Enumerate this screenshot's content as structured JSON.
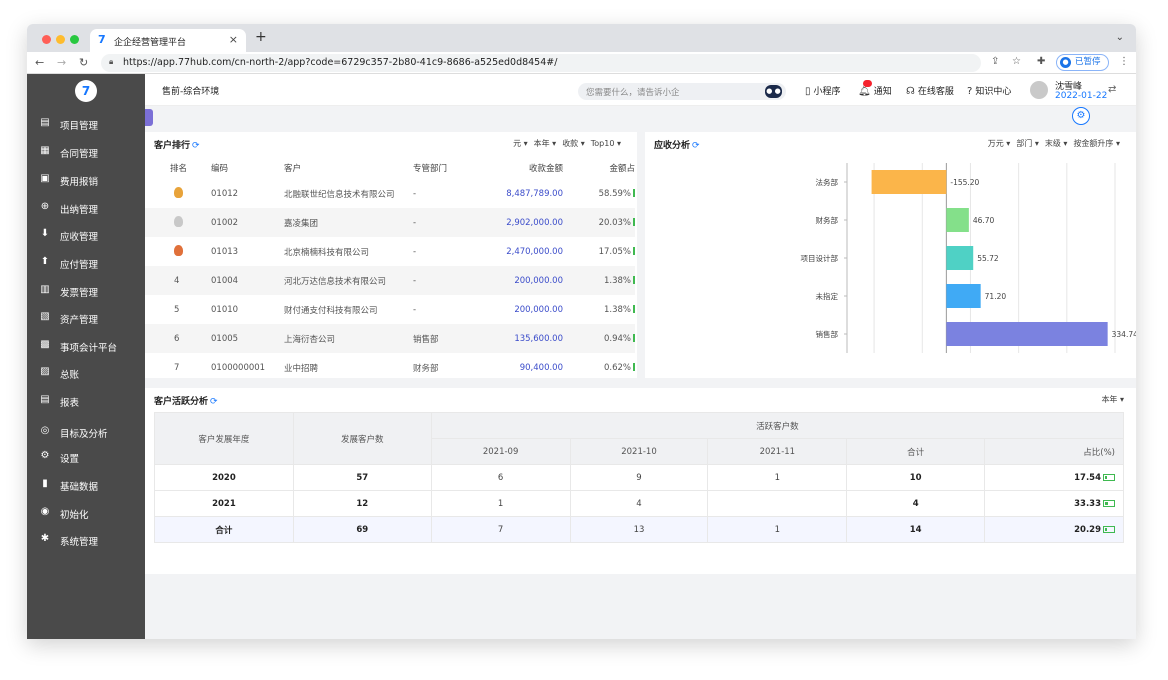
{
  "browser": {
    "tab_title": "企企经营管理平台",
    "url": "https://app.77hub.com/cn-north-2/app?code=6729c357-2b80-41c9-8686-a525ed0d8454#/",
    "paused_label": "已暂停",
    "window_dots": [
      "#ff5f57",
      "#febc2e",
      "#28c840"
    ]
  },
  "sidebar": {
    "items": [
      {
        "label": "项目管理",
        "icon": "folder-icon"
      },
      {
        "label": "合同管理",
        "icon": "contract-icon"
      },
      {
        "label": "费用报销",
        "icon": "expense-icon"
      },
      {
        "label": "出纳管理",
        "icon": "cashier-icon"
      },
      {
        "label": "应收管理",
        "icon": "receivable-icon"
      },
      {
        "label": "应付管理",
        "icon": "payable-icon"
      },
      {
        "label": "发票管理",
        "icon": "invoice-icon"
      },
      {
        "label": "资产管理",
        "icon": "asset-icon"
      },
      {
        "label": "事项会计平台",
        "icon": "grid-icon"
      },
      {
        "label": "总账",
        "icon": "ledger-icon"
      },
      {
        "label": "报表",
        "icon": "report-icon"
      },
      {
        "label": "目标及分析",
        "icon": "target-icon"
      },
      {
        "label": "设置",
        "icon": "gear-icon"
      },
      {
        "label": "基础数据",
        "icon": "bar-chart-icon"
      },
      {
        "label": "初始化",
        "icon": "init-icon"
      },
      {
        "label": "系统管理",
        "icon": "system-icon"
      }
    ]
  },
  "header": {
    "env": "售前-综合环境",
    "search_placeholder": "您需要什么，请告诉小企",
    "miniprogram": "小程序",
    "notify": "通知",
    "service": "在线客服",
    "knowledge": "知识中心",
    "user_name": "沈雪峰",
    "user_date": "2022-01-22"
  },
  "ranking": {
    "title": "客户排行",
    "filters": [
      "元 ▾",
      "本年 ▾",
      "收款 ▾",
      "Top10 ▾"
    ],
    "columns": [
      "排名",
      "编码",
      "客户",
      "专管部门",
      "收款金额",
      "金额占"
    ],
    "rows": [
      {
        "rank": "",
        "medal": "#e8a33a",
        "code": "01012",
        "customer": "北融联世纪信息技术有限公司",
        "dept": "-",
        "amount": "8,487,789.00",
        "pct": "58.59%"
      },
      {
        "rank": "",
        "medal": "#c8c8c8",
        "code": "01002",
        "customer": "嘉凌集团",
        "dept": "-",
        "amount": "2,902,000.00",
        "pct": "20.03%"
      },
      {
        "rank": "",
        "medal": "#e0703a",
        "code": "01013",
        "customer": "北京楠楠科技有限公司",
        "dept": "-",
        "amount": "2,470,000.00",
        "pct": "17.05%"
      },
      {
        "rank": "4",
        "medal": "",
        "code": "01004",
        "customer": "河北万达信息技术有限公司",
        "dept": "-",
        "amount": "200,000.00",
        "pct": "1.38%"
      },
      {
        "rank": "5",
        "medal": "",
        "code": "01010",
        "customer": "财付通支付科技有限公司",
        "dept": "-",
        "amount": "200,000.00",
        "pct": "1.38%"
      },
      {
        "rank": "6",
        "medal": "",
        "code": "01005",
        "customer": "上海衍杏公司",
        "dept": "销售部",
        "amount": "135,600.00",
        "pct": "0.94%"
      },
      {
        "rank": "7",
        "medal": "",
        "code": "0100000001",
        "customer": "业中招聘",
        "dept": "财务部",
        "amount": "90,400.00",
        "pct": "0.62%"
      }
    ]
  },
  "receivable": {
    "title": "应收分析",
    "filters": [
      "万元 ▾",
      "部门 ▾",
      "末级 ▾",
      "按金额升序 ▾"
    ]
  },
  "chart_data": {
    "type": "bar",
    "orientation": "horizontal",
    "categories": [
      "法务部",
      "财务部",
      "项目设计部",
      "未指定",
      "销售部"
    ],
    "values": [
      -155.2,
      46.7,
      55.72,
      71.2,
      334.74
    ],
    "value_labels": [
      "-155.20",
      "46.70",
      "55.72",
      "71.20",
      "334.74"
    ],
    "colors": [
      "#fbb54a",
      "#84e08a",
      "#4fd1c5",
      "#40aaf5",
      "#7b82e0"
    ],
    "xlim": [
      -200,
      350
    ],
    "grid": true
  },
  "activity": {
    "title": "客户活跃分析",
    "filter": "本年 ▾",
    "headers": {
      "year": "客户发展年度",
      "dev": "发展客户数",
      "active": "活跃客户数",
      "months": [
        "2021-09",
        "2021-10",
        "2021-11"
      ],
      "total": "合计",
      "ratio": "占比(%)"
    },
    "rows": [
      {
        "year": "2020",
        "dev": "57",
        "m1": "6",
        "m2": "9",
        "m3": "1",
        "total": "10",
        "ratio": "17.54",
        "fill": 0.1754
      },
      {
        "year": "2021",
        "dev": "12",
        "m1": "1",
        "m2": "4",
        "m3": "",
        "total": "4",
        "ratio": "33.33",
        "fill": 0.3333
      },
      {
        "year": "合计",
        "dev": "69",
        "m1": "7",
        "m2": "13",
        "m3": "1",
        "total": "14",
        "ratio": "20.29",
        "fill": 0.2029
      }
    ]
  }
}
